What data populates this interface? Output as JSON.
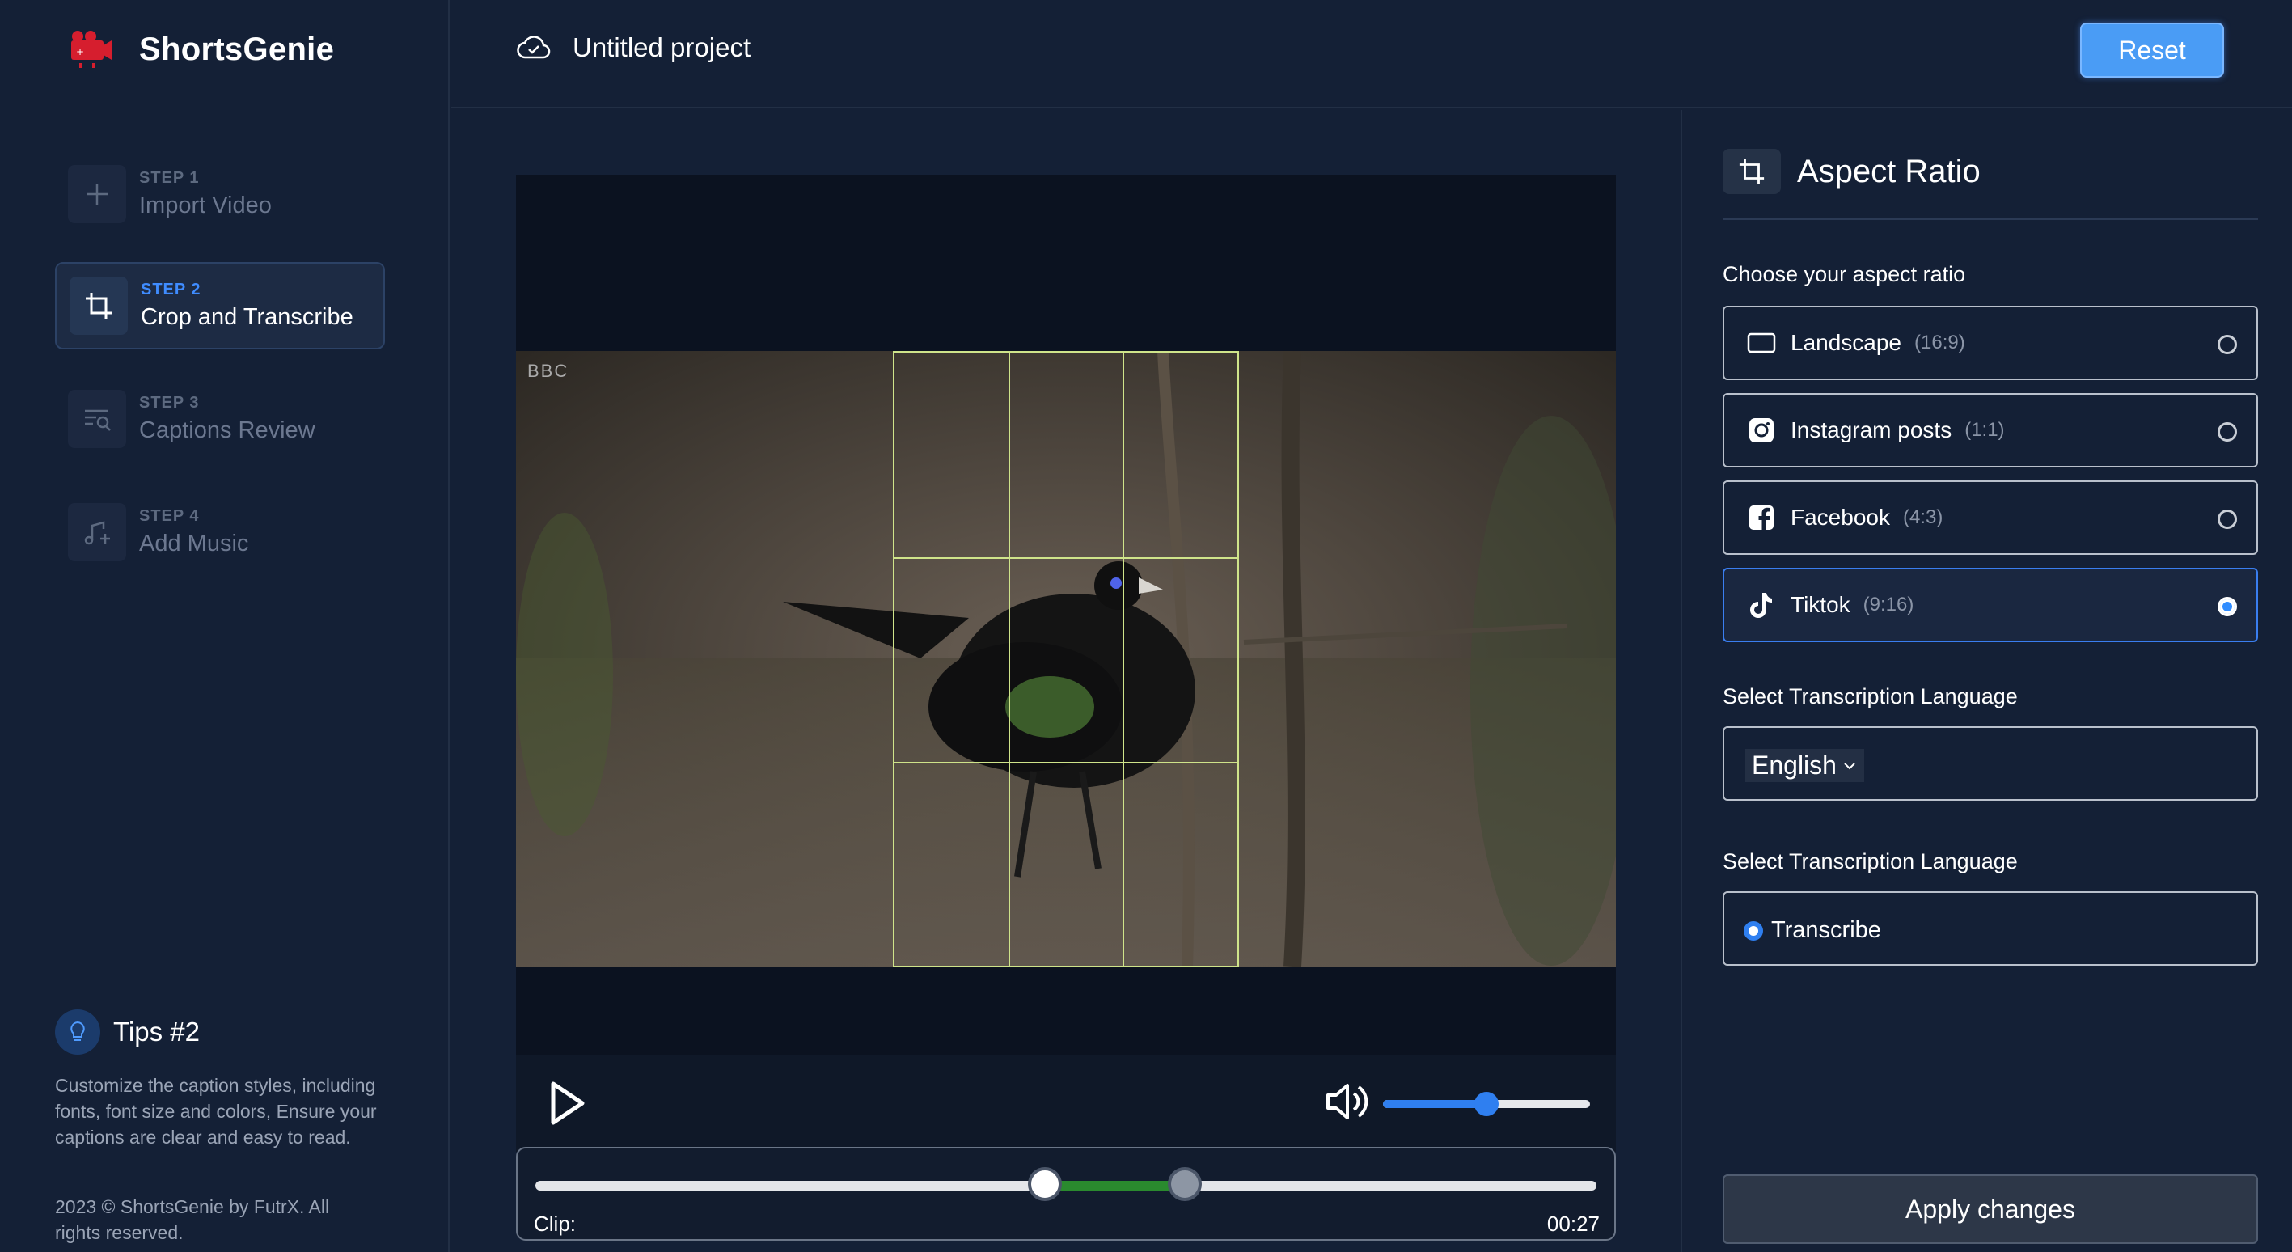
{
  "app": {
    "name": "ShortsGenie"
  },
  "header": {
    "project_title": "Untitled project",
    "reset_label": "Reset"
  },
  "steps": [
    {
      "label": "STEP 1",
      "title": "Import Video",
      "icon": "plus-icon"
    },
    {
      "label": "STEP 2",
      "title": "Crop and Transcribe",
      "icon": "crop-icon",
      "active": true
    },
    {
      "label": "STEP 3",
      "title": "Captions Review",
      "icon": "caption-search-icon"
    },
    {
      "label": "STEP 4",
      "title": "Add Music",
      "icon": "music-add-icon"
    }
  ],
  "tips": {
    "title": "Tips #2",
    "text": "Customize the caption styles, including fonts, font size and colors, Ensure your captions are clear and easy to read."
  },
  "footer": {
    "copyright": "2023 © ShortsGenie by FutrX. All rights reserved."
  },
  "video": {
    "watermark": "BBC",
    "volume_fraction": 0.5,
    "clip_start_fraction": 0.48,
    "clip_end_fraction": 0.612,
    "clip_label": "Clip:",
    "duration": "00:27"
  },
  "panel": {
    "title": "Aspect Ratio",
    "choose_label": "Choose your aspect ratio",
    "options": [
      {
        "name": "Landscape",
        "ratio": "(16:9)",
        "icon": "landscape-icon",
        "selected": false
      },
      {
        "name": "Instagram posts",
        "ratio": "(1:1)",
        "icon": "instagram-icon",
        "selected": false
      },
      {
        "name": "Facebook",
        "ratio": "(4:3)",
        "icon": "facebook-icon",
        "selected": false
      },
      {
        "name": "Tiktok",
        "ratio": "(9:16)",
        "icon": "tiktok-icon",
        "selected": true
      }
    ],
    "language_label": "Select Transcription Language",
    "language_value": "English",
    "transcribe_label": "Select Transcription Language",
    "transcribe_option": "Transcribe",
    "apply_label": "Apply changes"
  },
  "colors": {
    "accent": "#3f8cff",
    "background": "#142036",
    "crop_grid": "#cfe48a",
    "clip_selection": "#2a8a2e"
  }
}
